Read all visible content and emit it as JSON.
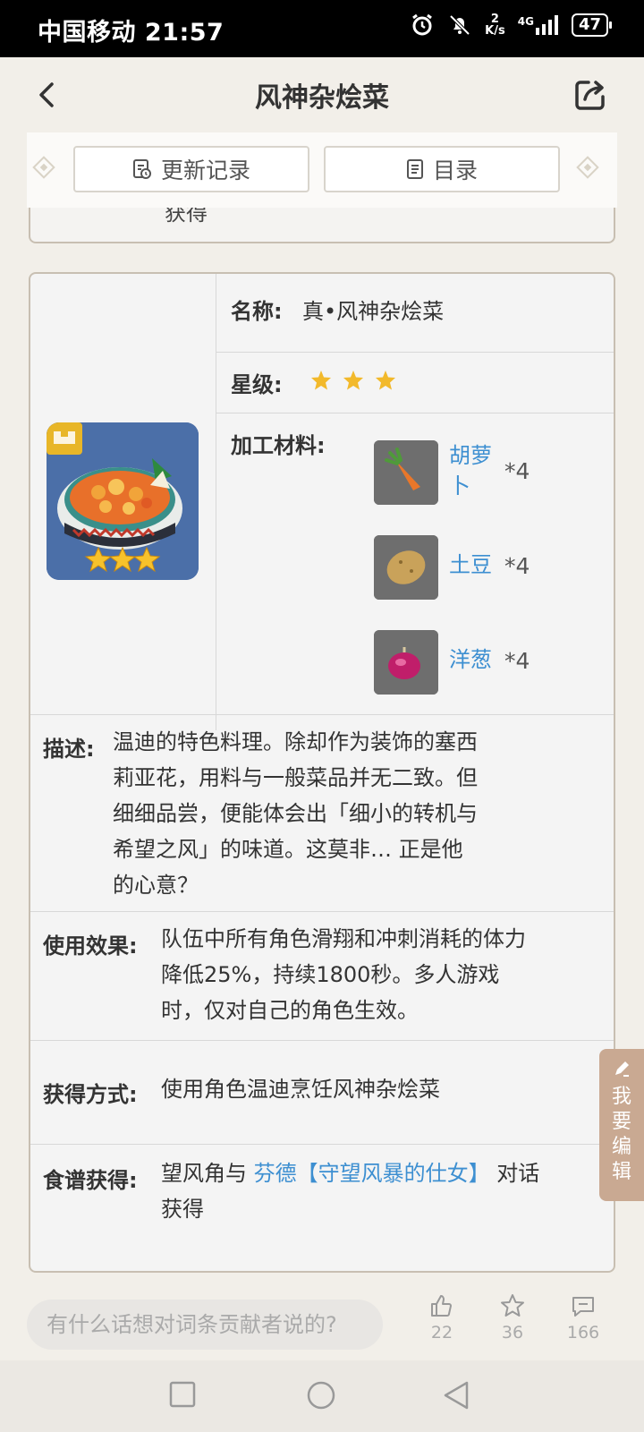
{
  "status_bar": {
    "carrier_time": "中国移动 21:57",
    "speed_value": "2",
    "speed_unit": "K/s",
    "network": "4G",
    "battery": "47"
  },
  "header": {
    "title": "风神杂烩菜"
  },
  "tabs": {
    "update_log": "更新记录",
    "contents": "目录"
  },
  "previous_section": {
    "trailing_text": "获得"
  },
  "dish": {
    "name_label": "名称:",
    "name_value": "真•风神杂烩菜",
    "rarity_label": "星级:",
    "rarity_stars": 3,
    "materials_label": "加工材料:",
    "materials": [
      {
        "name": "胡萝卜",
        "qty": "*4"
      },
      {
        "name": "土豆",
        "qty": "*4"
      },
      {
        "name": "洋葱",
        "qty": "*4"
      }
    ],
    "description_label": "描述:",
    "description": [
      "温迪的特色料理。除却作为装饰的塞西",
      "莉亚花，用料与一般菜品并无二致。但",
      "细细品尝，便能体会出「细小的转机与",
      "希望之风」的味道。这莫非… 正是他",
      "的心意？"
    ],
    "effect_label": "使用效果:",
    "effect": [
      "队伍中所有角色滑翔和冲刺消耗的体力",
      "降低25%，持续1800秒。多人游戏",
      "时，仅对自己的角色生效。"
    ],
    "obtain_label": "获得方式:",
    "obtain": "使用角色温迪烹饪风神杂烩菜",
    "recipe_label": "食谱获得:",
    "recipe_prefix": "望风角与",
    "recipe_link": "芬德【守望风暴的仕女】",
    "recipe_suffix": "对话",
    "recipe_line2": "获得"
  },
  "edit_tab": {
    "label": [
      "我",
      "要",
      "编",
      "辑"
    ]
  },
  "comment_bar": {
    "placeholder": "有什么话想对词条贡献者说的?",
    "likes": "22",
    "favorites": "36",
    "comments": "166"
  },
  "colors": {
    "link": "#3d8fd1",
    "star": "#f2b92b",
    "edit_tab": "#c9a992"
  }
}
